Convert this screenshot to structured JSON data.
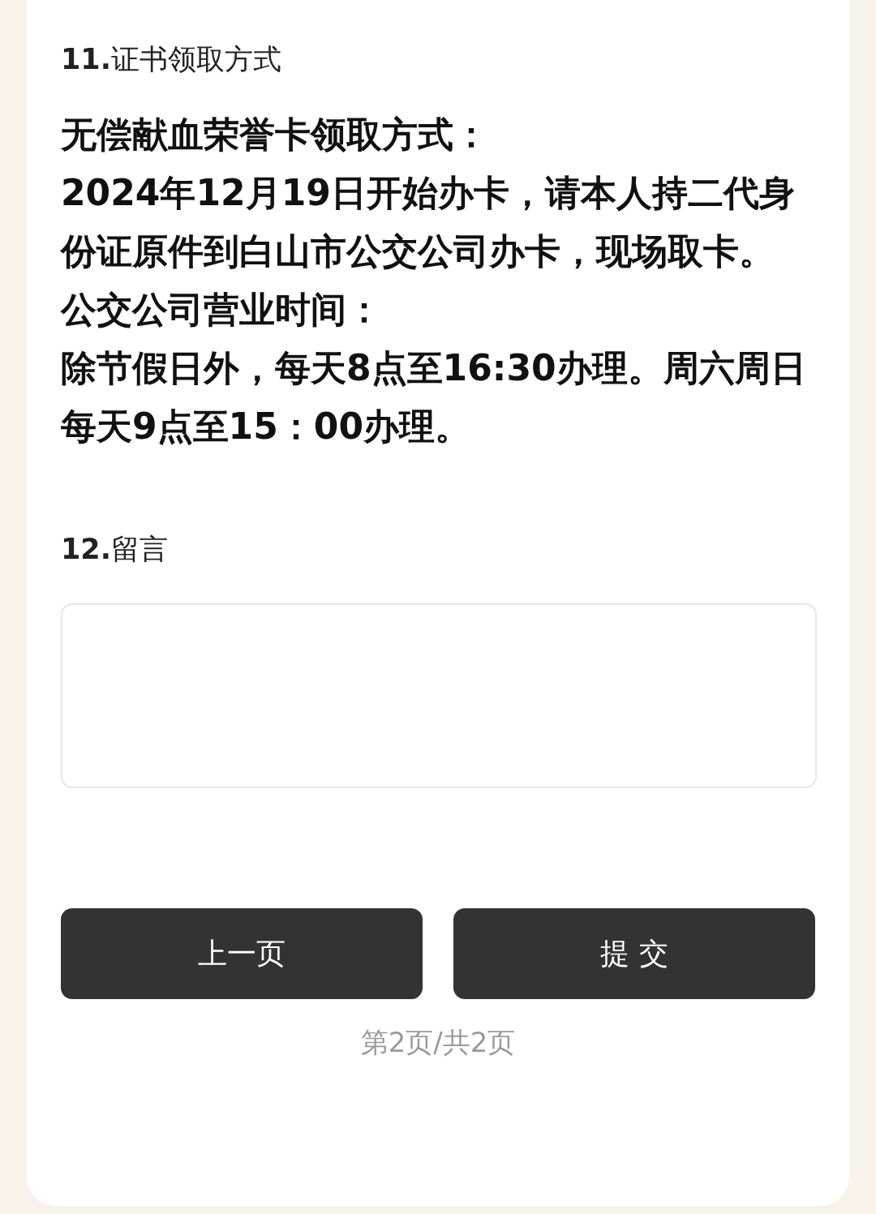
{
  "questions": [
    {
      "kind": "info",
      "title": "**11.**证书领取方式",
      "paragraphs": [
        "无偿献血荣誉卡领取方式：",
        "2024年12月19日开始办卡，请本人持二代身份证原件到白山市公交公司办卡，现场取卡。",
        "公交公司营业时间：",
        "除节假日外，每天8点至16:30办理。周六周日每天9点至15：00办理。"
      ]
    },
    {
      "kind": "textarea",
      "title": "**12.**留言"
    }
  ],
  "buttons": [
    {
      "label": "上一页"
    },
    {
      "label": "提 交"
    }
  ],
  "page_indicator": "第2页/共2页"
}
